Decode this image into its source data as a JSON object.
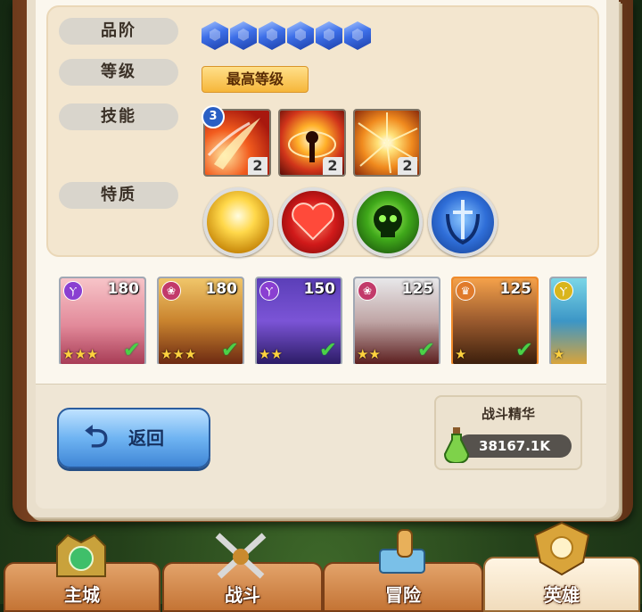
{
  "labels": {
    "quality": "品阶",
    "level": "等级",
    "skills": "技能",
    "traits": "特质"
  },
  "quality_gems": 6,
  "level_badge": "最高等级",
  "skill_count": "3",
  "skills": [
    {
      "level": "2",
      "icon": "fire-slash-icon"
    },
    {
      "level": "2",
      "icon": "solar-burst-icon"
    },
    {
      "level": "2",
      "icon": "radiant-flash-icon"
    }
  ],
  "traits": [
    {
      "icon": "golden-radiance-icon"
    },
    {
      "icon": "heart-icon"
    },
    {
      "icon": "poison-skull-icon"
    },
    {
      "icon": "sword-shield-icon"
    }
  ],
  "heroes": [
    {
      "level": "180",
      "stars": "★★★",
      "class_color": "#8a3fd1"
    },
    {
      "level": "180",
      "stars": "★★★",
      "class_color": "#c23a6a"
    },
    {
      "level": "150",
      "stars": "★★",
      "class_color": "#8a3fd1"
    },
    {
      "level": "125",
      "stars": "★★",
      "class_color": "#c23a6a"
    },
    {
      "level": "125",
      "stars": "★",
      "class_color": "#e07a2a"
    },
    {
      "level": "",
      "stars": "★",
      "class_color": "#d9b51c"
    }
  ],
  "back_label": "返回",
  "essence": {
    "title": "战斗精华",
    "value": "38167.1K"
  },
  "nav": {
    "home": "主城",
    "battle": "战斗",
    "adventure": "冒险",
    "heroes": "英雄"
  }
}
